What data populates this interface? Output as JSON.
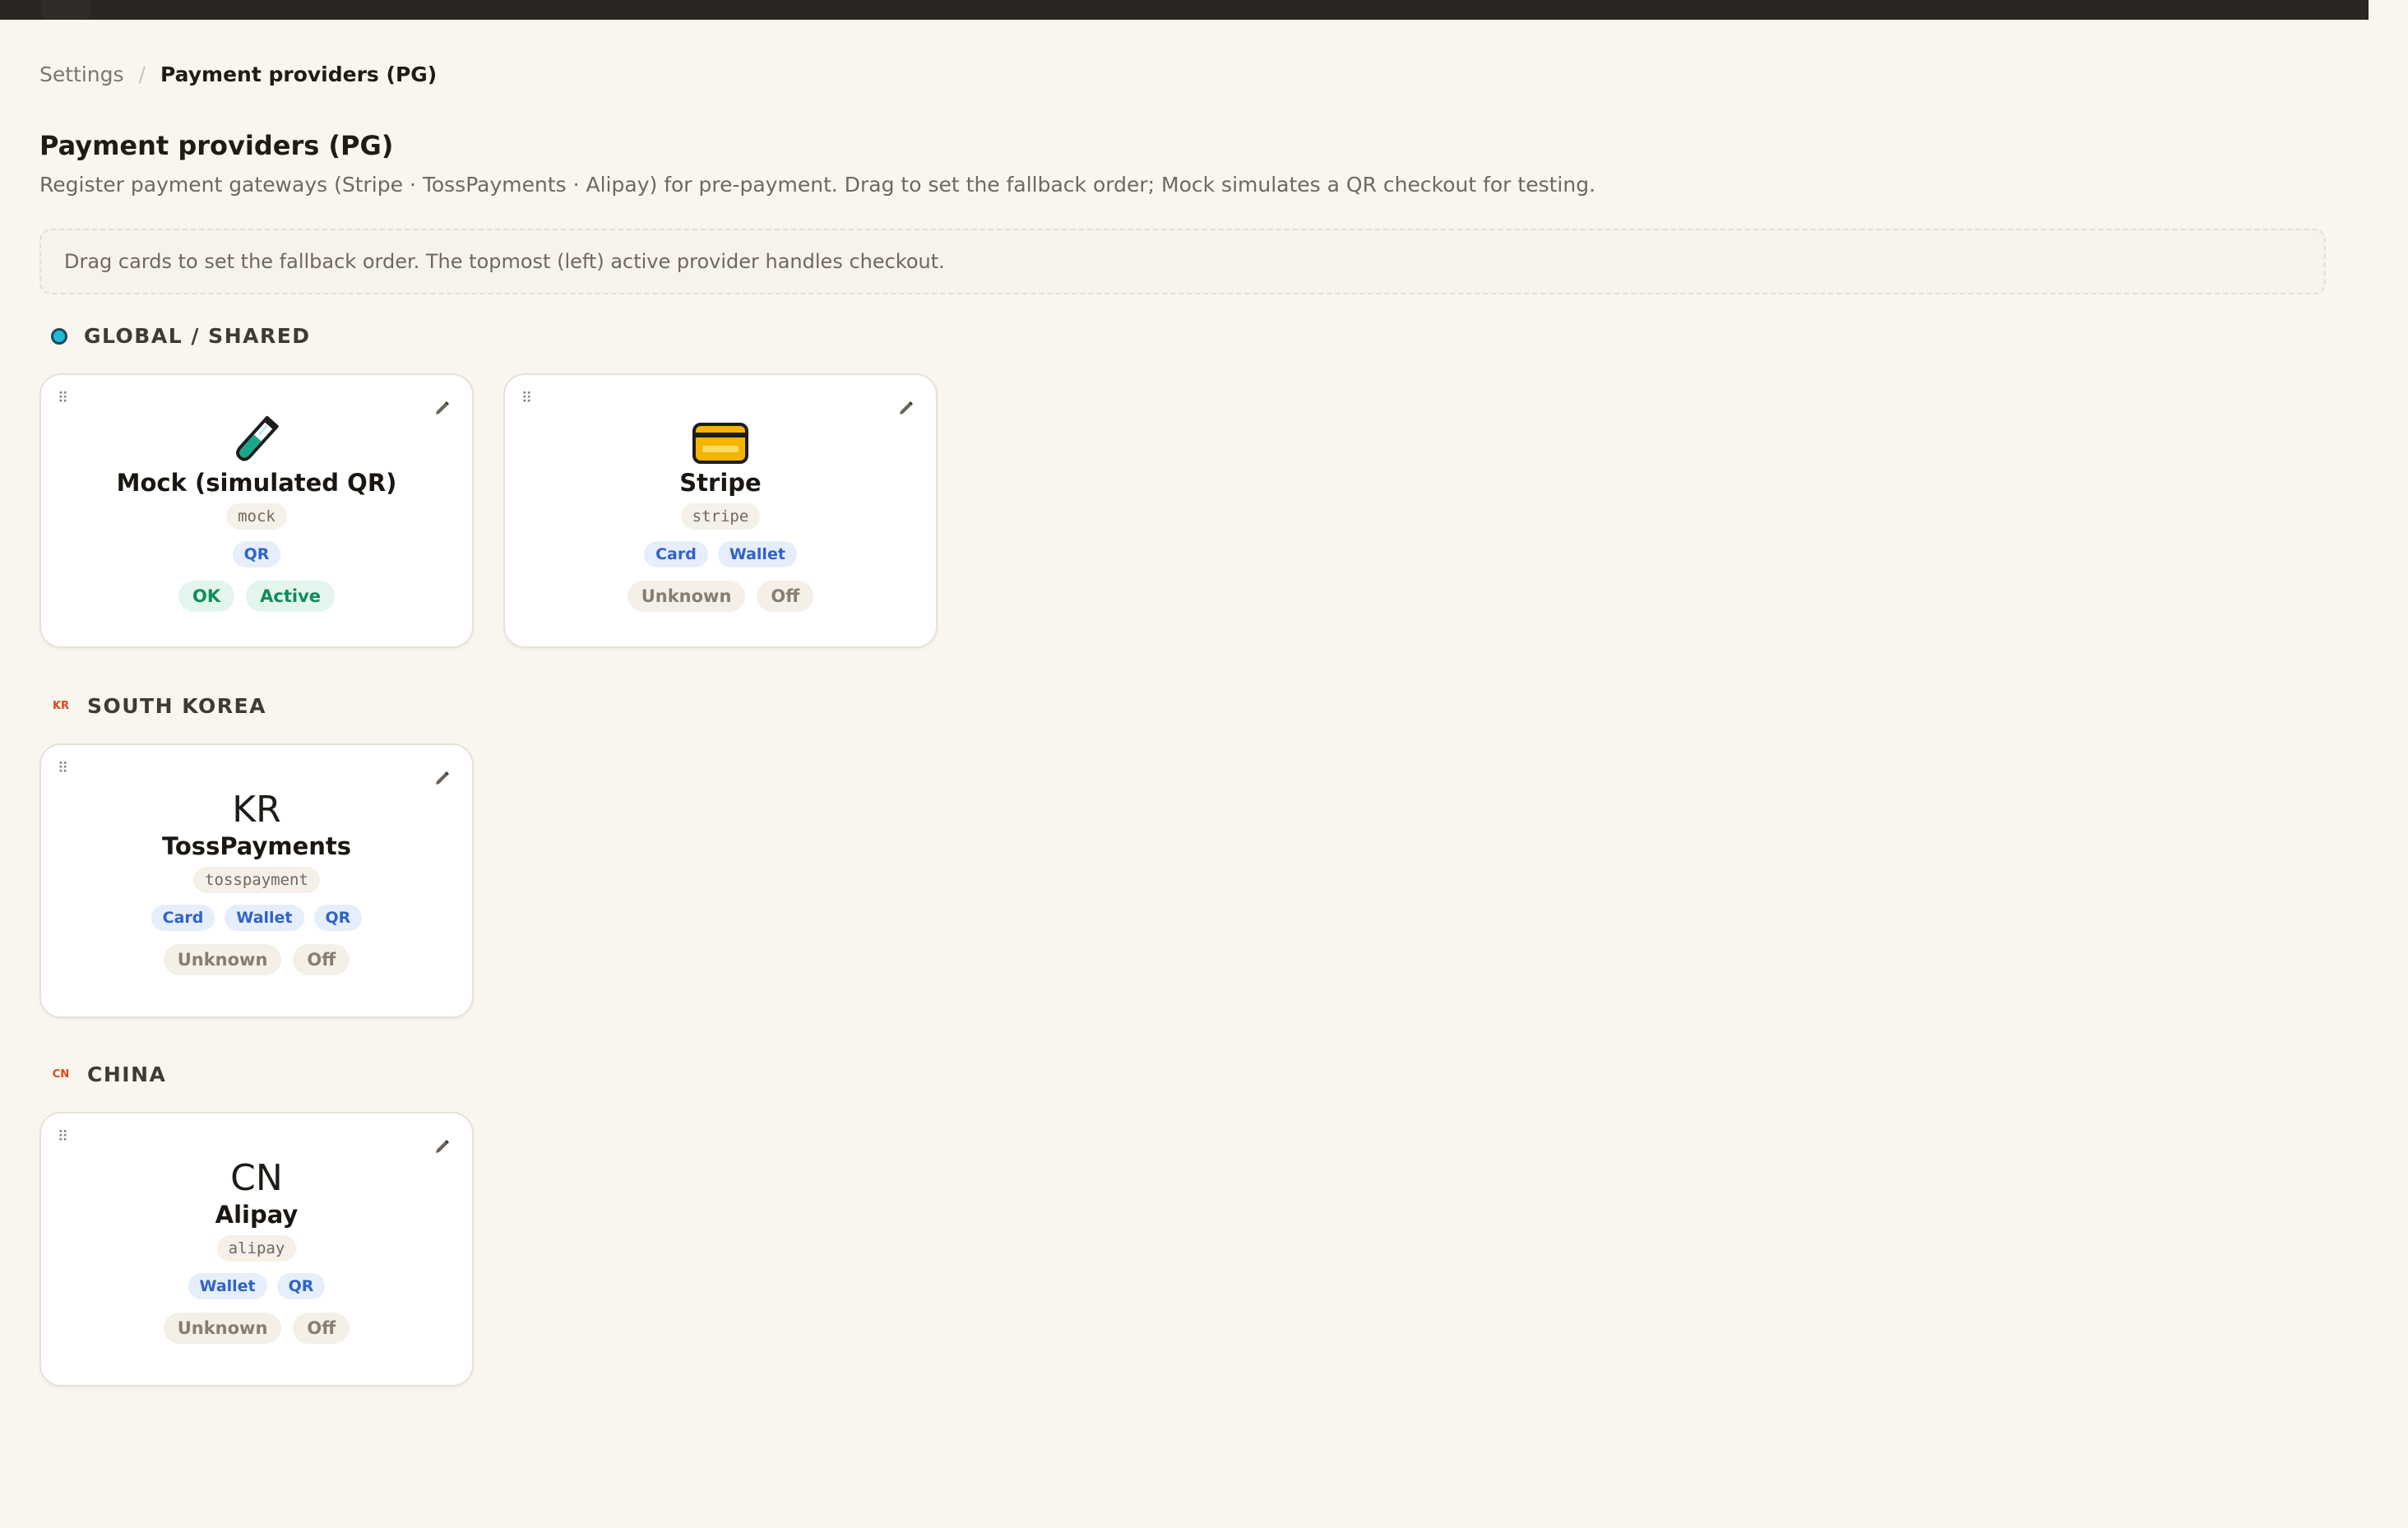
{
  "breadcrumb": {
    "parent": "Settings",
    "separator": "/",
    "current": "Payment providers (PG)"
  },
  "page": {
    "title": "Payment providers (PG)",
    "description": "Register payment gateways (Stripe · TossPayments · Alipay) for pre-payment. Drag to set the fallback order; Mock simulates a QR checkout for testing.",
    "hint": "Drag cards to set the fallback order. The topmost (left) active provider handles checkout."
  },
  "groups": {
    "global": {
      "label": "GLOBAL / SHARED",
      "icon": "globe-icon",
      "cards": [
        {
          "icon": "test-tube-icon",
          "name": "Mock (simulated QR)",
          "code": "mock",
          "tags": [
            "QR"
          ],
          "health": "OK",
          "state": "Active"
        },
        {
          "icon": "credit-card-icon",
          "name": "Stripe",
          "code": "stripe",
          "tags": [
            "Card",
            "Wallet"
          ],
          "health": "Unknown",
          "state": "Off"
        }
      ]
    },
    "kr": {
      "label": "SOUTH KOREA",
      "flag_code": "KR",
      "cards": [
        {
          "region": "KR",
          "name": "TossPayments",
          "code": "tosspayment",
          "tags": [
            "Card",
            "Wallet",
            "QR"
          ],
          "health": "Unknown",
          "state": "Off"
        }
      ]
    },
    "cn": {
      "label": "CHINA",
      "flag_code": "CN",
      "cards": [
        {
          "region": "CN",
          "name": "Alipay",
          "code": "alipay",
          "tags": [
            "Wallet",
            "QR"
          ],
          "health": "Unknown",
          "state": "Off"
        }
      ]
    }
  },
  "colors": {
    "background": "#f9f6f0",
    "topbar": "#2a2622",
    "accent_tag": "#2e63c9",
    "ok": "#0e8c5c",
    "flag_red": "#e0441f"
  },
  "icons": {
    "drag": "drag-handle-icon",
    "edit": "pencil-icon"
  }
}
